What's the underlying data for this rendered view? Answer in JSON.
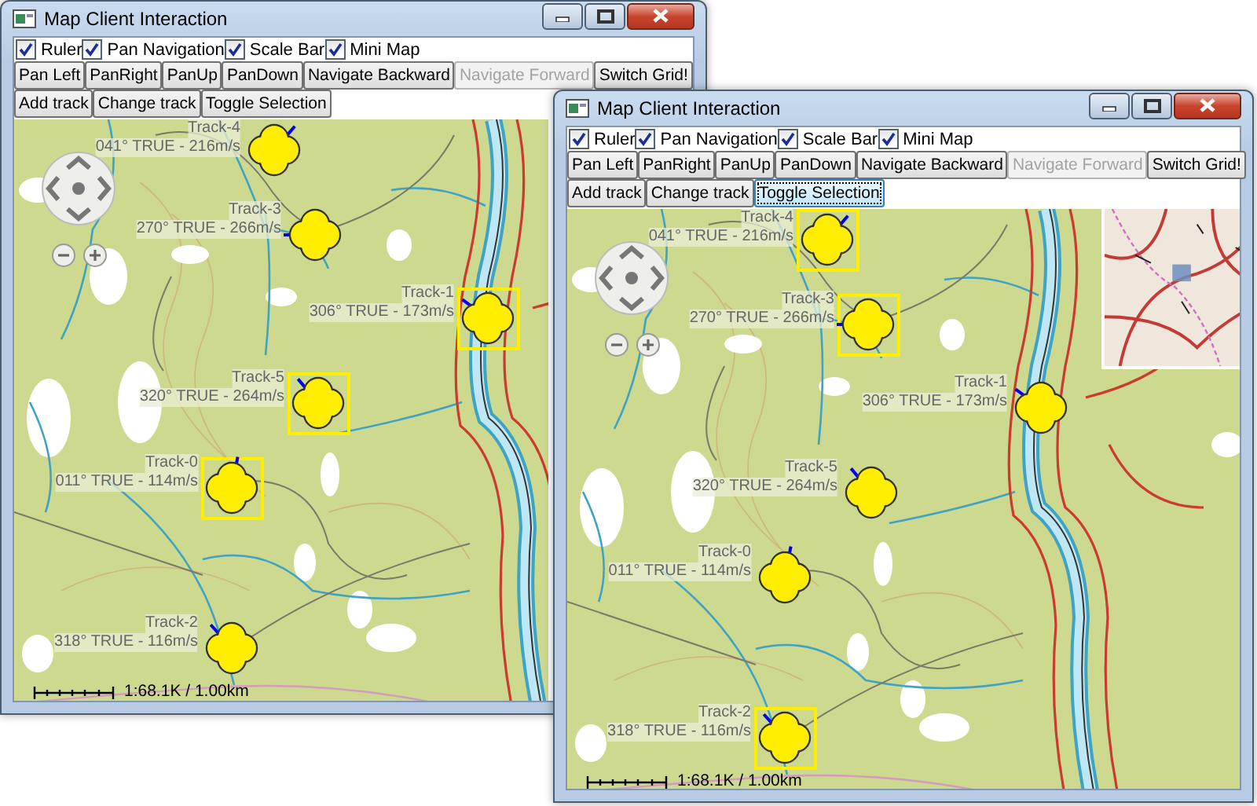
{
  "windows": [
    {
      "title": "Map Client Interaction",
      "options": [
        {
          "label": "Ruler",
          "checked": true
        },
        {
          "label": "Pan Navigation",
          "checked": true
        },
        {
          "label": "Scale Bar",
          "checked": true
        },
        {
          "label": "Mini Map",
          "checked": true
        }
      ],
      "toolbar_rows": [
        {
          "buttons": [
            {
              "label": "Pan Left",
              "disabled": false,
              "focused": false
            },
            {
              "label": "PanRight",
              "disabled": false,
              "focused": false
            },
            {
              "label": "PanUp",
              "disabled": false,
              "focused": false
            },
            {
              "label": "PanDown",
              "disabled": false,
              "focused": false
            },
            {
              "label": "Navigate Backward",
              "disabled": false,
              "focused": false
            },
            {
              "label": "Navigate Forward",
              "disabled": true,
              "focused": false
            },
            {
              "label": "Switch Grid!",
              "disabled": false,
              "focused": false
            }
          ]
        },
        {
          "buttons": [
            {
              "label": "Add track",
              "disabled": false,
              "focused": false
            },
            {
              "label": "Change track",
              "disabled": false,
              "focused": false
            },
            {
              "label": "Toggle Selection",
              "disabled": false,
              "focused": false
            }
          ]
        }
      ],
      "map": {
        "tracks": [
          {
            "name": "Track-4",
            "label": "041° TRUE - 216m/s",
            "selected": false
          },
          {
            "name": "Track-3",
            "label": "270° TRUE - 266m/s",
            "selected": false
          },
          {
            "name": "Track-1",
            "label": "306° TRUE - 173m/s",
            "selected": true
          },
          {
            "name": "Track-5",
            "label": "320° TRUE - 264m/s",
            "selected": true
          },
          {
            "name": "Track-0",
            "label": "011° TRUE - 114m/s",
            "selected": true
          },
          {
            "name": "Track-2",
            "label": "318° TRUE - 116m/s",
            "selected": false
          }
        ],
        "scale": "1:68.1K / 1.00km"
      }
    },
    {
      "title": "Map Client Interaction",
      "options": [
        {
          "label": "Ruler",
          "checked": true
        },
        {
          "label": "Pan Navigation",
          "checked": true
        },
        {
          "label": "Scale Bar",
          "checked": true
        },
        {
          "label": "Mini Map",
          "checked": true
        }
      ],
      "toolbar_rows": [
        {
          "buttons": [
            {
              "label": "Pan Left",
              "disabled": false,
              "focused": false
            },
            {
              "label": "PanRight",
              "disabled": false,
              "focused": false
            },
            {
              "label": "PanUp",
              "disabled": false,
              "focused": false
            },
            {
              "label": "PanDown",
              "disabled": false,
              "focused": false
            },
            {
              "label": "Navigate Backward",
              "disabled": false,
              "focused": false
            },
            {
              "label": "Navigate Forward",
              "disabled": true,
              "focused": false
            },
            {
              "label": "Switch Grid!",
              "disabled": false,
              "focused": false
            }
          ]
        },
        {
          "buttons": [
            {
              "label": "Add track",
              "disabled": false,
              "focused": false
            },
            {
              "label": "Change track",
              "disabled": false,
              "focused": false
            },
            {
              "label": "Toggle Selection",
              "disabled": false,
              "focused": true
            }
          ]
        }
      ],
      "map": {
        "tracks": [
          {
            "name": "Track-4",
            "label": "041° TRUE - 216m/s",
            "selected": true
          },
          {
            "name": "Track-3",
            "label": "270° TRUE - 266m/s",
            "selected": true
          },
          {
            "name": "Track-1",
            "label": "306° TRUE - 173m/s",
            "selected": false
          },
          {
            "name": "Track-5",
            "label": "320° TRUE - 264m/s",
            "selected": false
          },
          {
            "name": "Track-0",
            "label": "011° TRUE - 114m/s",
            "selected": false
          },
          {
            "name": "Track-2",
            "label": "318° TRUE - 116m/s",
            "selected": true
          }
        ],
        "scale": "1:68.1K / 1.00km"
      }
    }
  ]
}
